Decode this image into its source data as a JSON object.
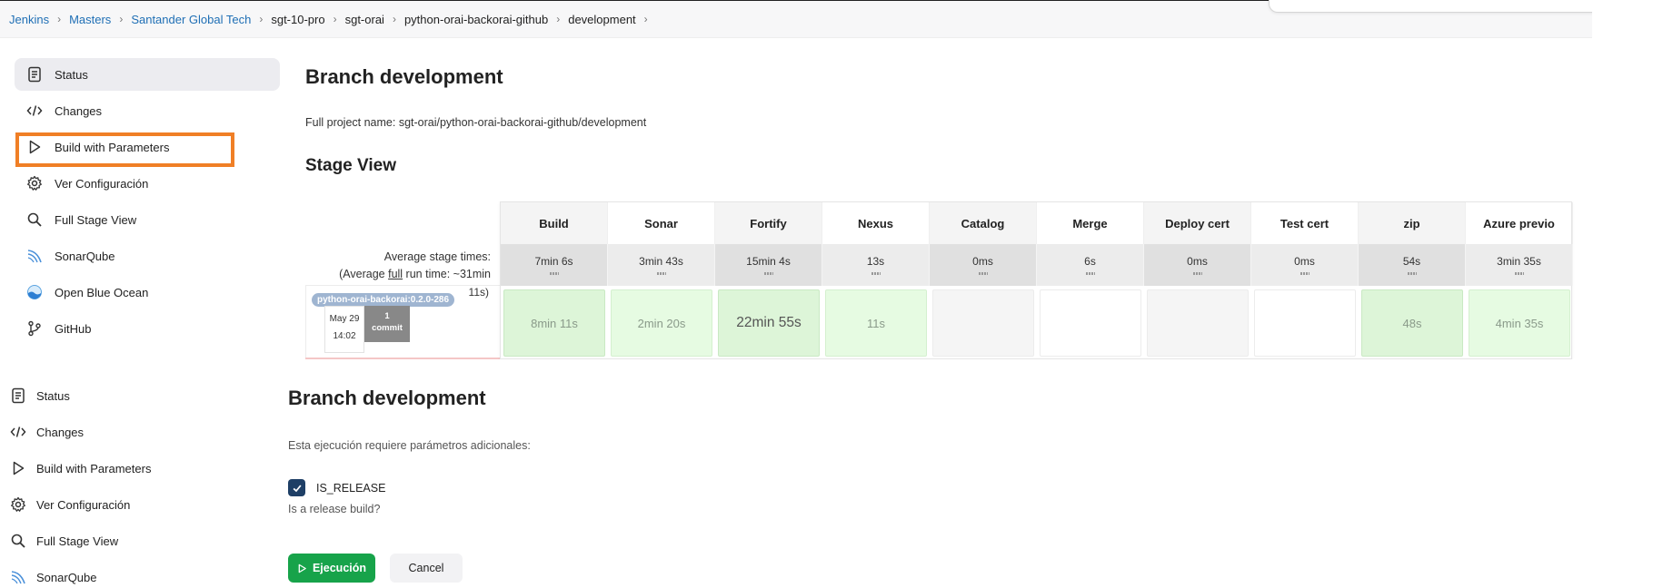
{
  "breadcrumb": [
    "Jenkins",
    "Masters",
    "Santander Global Tech",
    "sgt-10-pro",
    "sgt-orai",
    "python-orai-backorai-github",
    "development"
  ],
  "sidebar_top": [
    {
      "label": "Status",
      "icon": "document-icon"
    },
    {
      "label": "Changes",
      "icon": "code-icon"
    },
    {
      "label": "Build with Parameters",
      "icon": "play-icon"
    },
    {
      "label": "Ver Configuración",
      "icon": "gear-icon"
    },
    {
      "label": "Full Stage View",
      "icon": "search-icon"
    },
    {
      "label": "SonarQube",
      "icon": "sonarqube-icon"
    },
    {
      "label": "Open Blue Ocean",
      "icon": "blue-ocean-icon"
    },
    {
      "label": "GitHub",
      "icon": "git-branch-icon"
    }
  ],
  "main_top": {
    "title": "Branch development",
    "full_project_name": "Full project name: sgt-orai/python-orai-backorai-github/development",
    "stage_view_title": "Stage View"
  },
  "stage_view": {
    "avg_label": "Average stage times:",
    "full_run_prefix": "(Average ",
    "full_run_link": "full",
    "full_run_suffix": " run time: ~31min",
    "build_time_fragment": "11s)",
    "stages": [
      "Build",
      "Sonar",
      "Fortify",
      "Nexus",
      "Catalog",
      "Merge",
      "Deploy cert",
      "Test cert",
      "zip",
      "Azure previo"
    ],
    "averages": [
      "7min 6s",
      "3min 43s",
      "15min 4s",
      "13s",
      "0ms",
      "6s",
      "0ms",
      "0ms",
      "54s",
      "3min 35s"
    ],
    "run_cells": [
      "8min 11s",
      "2min 20s",
      "22min 55s",
      "11s",
      "",
      "",
      "",
      "",
      "48s",
      "4min 35s"
    ],
    "build_tag": "python-orai-backorai:0.2.0-286",
    "build_date": "May 29",
    "build_time": "14:02",
    "commit_count": "1",
    "commit_label": "commit"
  },
  "sidebar_bottom": [
    {
      "label": "Status",
      "icon": "document-icon"
    },
    {
      "label": "Changes",
      "icon": "code-icon"
    },
    {
      "label": "Build with Parameters",
      "icon": "play-icon"
    },
    {
      "label": "Ver Configuración",
      "icon": "gear-icon"
    },
    {
      "label": "Full Stage View",
      "icon": "search-icon"
    },
    {
      "label": "SonarQube",
      "icon": "sonarqube-icon"
    }
  ],
  "main_bottom": {
    "title": "Branch development",
    "requires_params": "Esta ejecución requiere parámetros adicionales:",
    "param_name": "IS_RELEASE",
    "param_checked": true,
    "param_hint": "Is a release build?",
    "run_button": "Ejecución",
    "cancel_button": "Cancel"
  },
  "colors": {
    "link": "#1f6fb5",
    "highlight": "#f07f26",
    "run_button": "#17a34a",
    "checkbox": "#1e3f66",
    "stage_success": "#ddf5d8"
  }
}
